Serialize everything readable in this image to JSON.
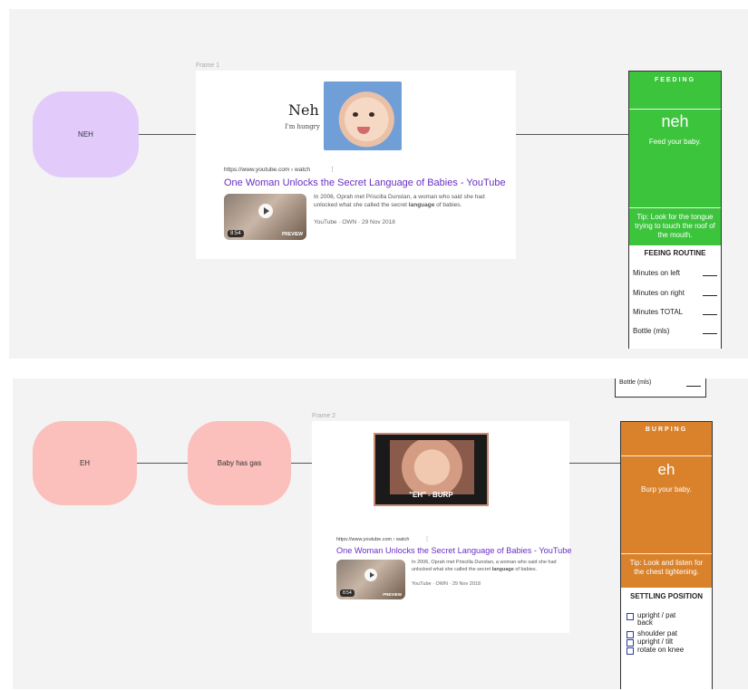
{
  "top": {
    "frame_label": "Frame 1",
    "node": {
      "label": "NEH",
      "color": "#e2cbfb"
    },
    "search": {
      "hero_word": "Neh",
      "hero_caption": "I'm hungry",
      "url": "https://www.youtube.com › watch",
      "title": "One Woman Unlocks the Secret Language of Babies - YouTube",
      "desc_prefix": "In 2006, Oprah met Priscilla Dunstan, a woman who said she had unlocked what she called the secret ",
      "desc_bold": "language",
      "desc_suffix": " of babies.",
      "meta": "YouTube · OWN · 29 Nov 2018",
      "duration": "8:54",
      "preview": "PREVIEW"
    },
    "card": {
      "color": "#3dc43d",
      "heading": "FEEDING",
      "word": "neh",
      "action": "Feed your baby.",
      "tip": "Tip: Look for the tongue trying to touch the roof of the mouth.",
      "section_title": "FEEING ROUTINE",
      "rows": [
        "Minutes on left",
        "Minutes on right",
        "Minutes TOTAL",
        "Bottle (mls)"
      ]
    }
  },
  "bottom": {
    "frame_label": "Frame 2",
    "top_fragment": "Bottle (mls)",
    "nodes": [
      {
        "label": "EH",
        "color": "#fbc0bb"
      },
      {
        "label": "Baby has gas",
        "color": "#fbc0bb"
      }
    ],
    "search": {
      "gif_caption": "\"EH\" - BURP",
      "url": "https://www.youtube.com › watch",
      "title": "One Woman Unlocks the Secret Language of Babies - YouTube",
      "desc_prefix": "In 2006, Oprah met Priscilla Dunstan, a woman who said she had unlocked what she called the secret ",
      "desc_bold": "language",
      "desc_suffix": " of babies.",
      "meta": "YouTube · OWN · 29 Nov 2018",
      "duration": "8:54",
      "preview": "PREVIEW"
    },
    "card": {
      "color": "#d9822b",
      "heading": "BURPING",
      "word": "eh",
      "action": "Burp your baby.",
      "tip": "Tip: Look and listen for the chest tightening.",
      "section_title": "SETTLING POSITION",
      "options": [
        "upright / pat back",
        "shoulder pat",
        "upright / tilt",
        "rotate on knee"
      ]
    }
  }
}
